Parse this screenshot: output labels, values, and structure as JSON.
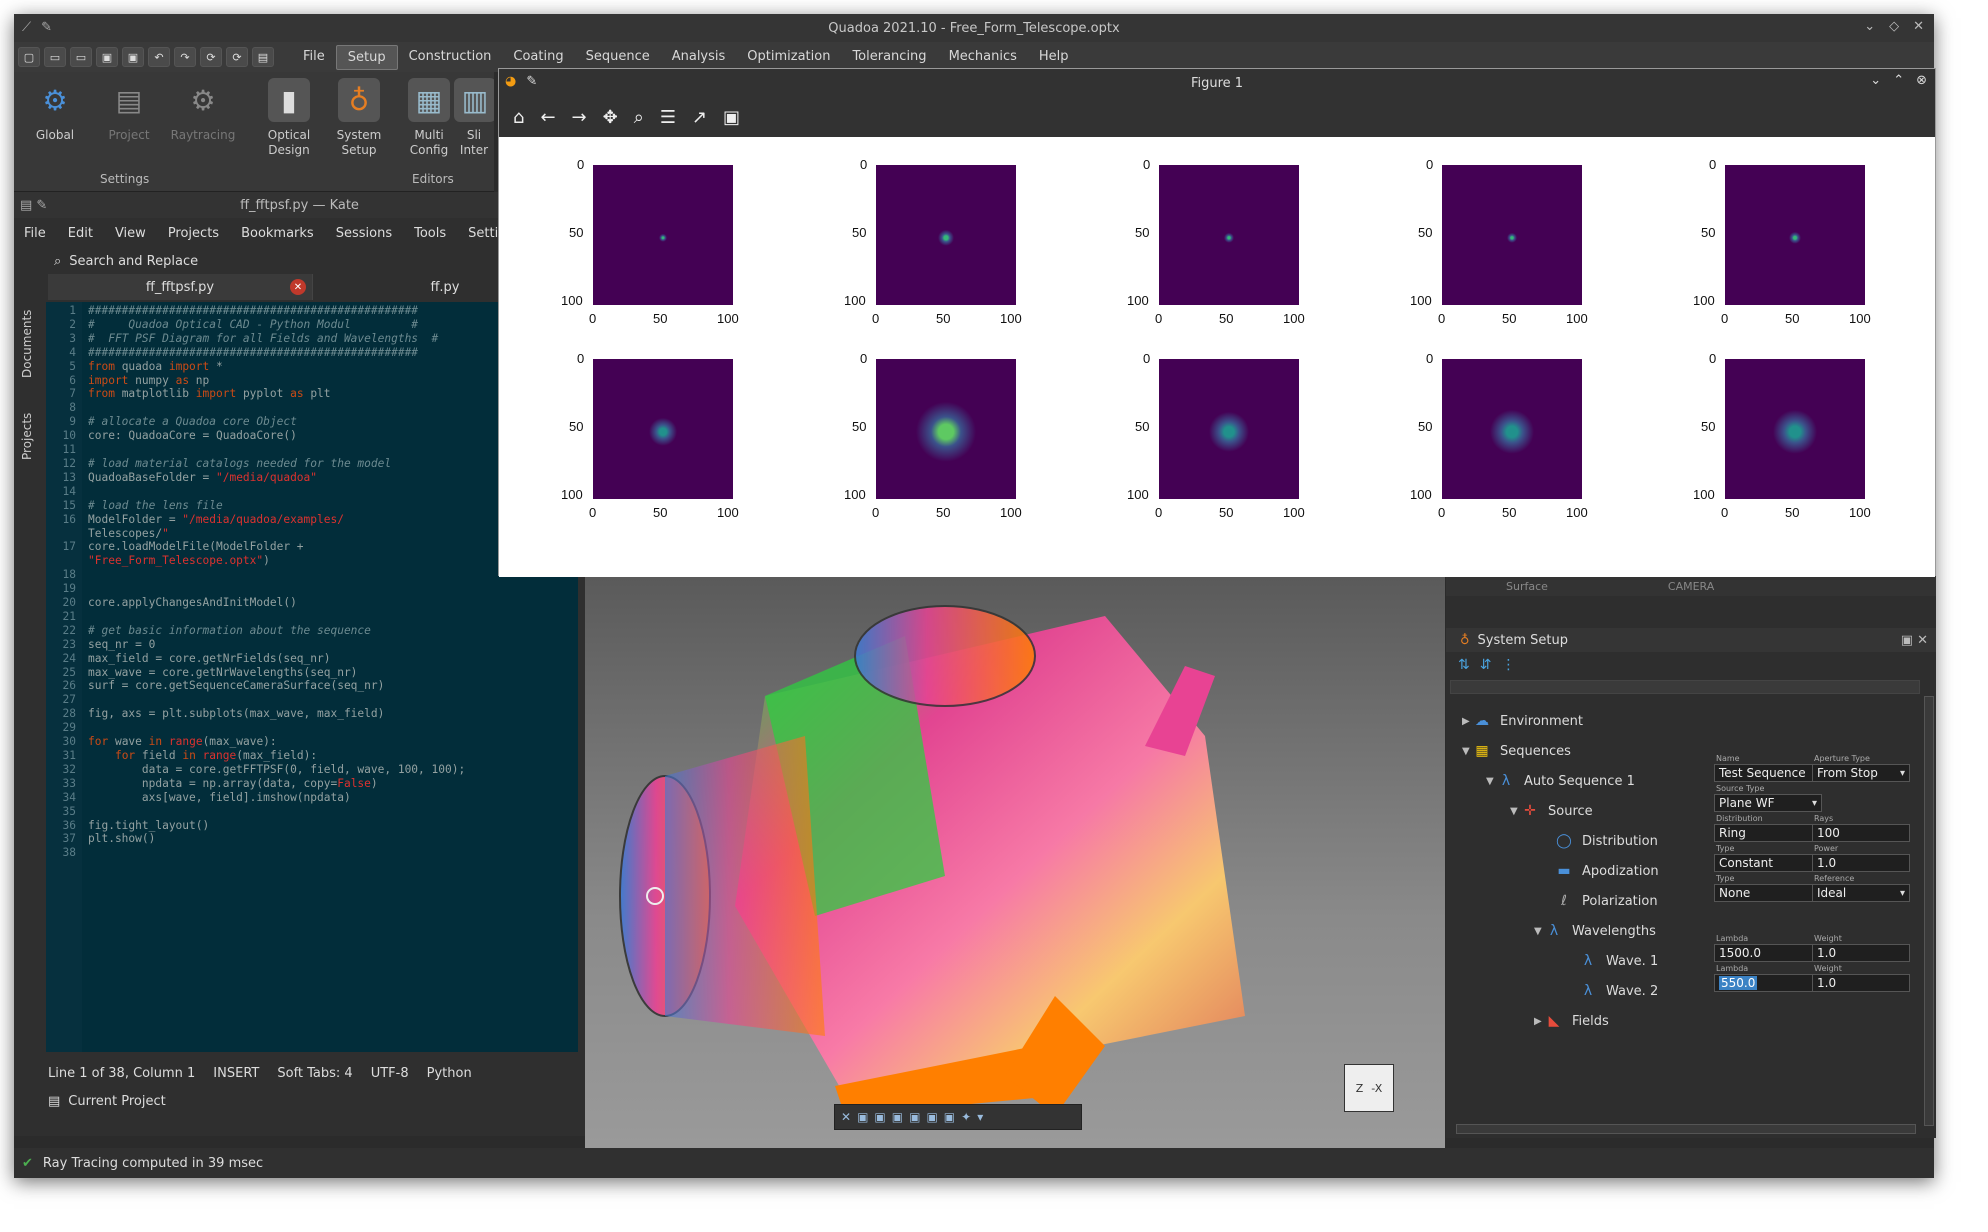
{
  "app": {
    "title": "Quadoa 2021.10 - Free_Form_Telescope.optx",
    "menu": [
      "File",
      "Setup",
      "Construction",
      "Coating",
      "Sequence",
      "Analysis",
      "Optimization",
      "Tolerancing",
      "Mechanics",
      "Help"
    ],
    "active_menu": "Setup"
  },
  "ribbon": {
    "settings_group": "Settings",
    "editors_group": "Editors",
    "buttons": [
      {
        "label": "Global",
        "icon": "gears-icon"
      },
      {
        "label": "Project",
        "icon": "document-gear-icon"
      },
      {
        "label": "Raytracing",
        "icon": "gpu-gear-icon"
      },
      {
        "label": "Optical\nDesign",
        "icon": "optical-design-icon"
      },
      {
        "label": "System\nSetup",
        "icon": "bulb-icon"
      },
      {
        "label": "Multi\nConfig",
        "icon": "multi-config-icon"
      },
      {
        "label": "Sli\nInter",
        "icon": "slice-icon"
      }
    ]
  },
  "kate": {
    "title": "ff_fftpsf.py — Kate",
    "menu": [
      "File",
      "Edit",
      "View",
      "Projects",
      "Bookmarks",
      "Sessions",
      "Tools",
      "Setting"
    ],
    "search_label": "Search and Replace",
    "side_tabs": [
      "Documents",
      "Projects"
    ],
    "tabs": [
      "ff_fftpsf.py",
      "ff.py"
    ],
    "status": {
      "position": "Line 1 of 38, Column 1",
      "mode": "INSERT",
      "tabs": "Soft Tabs: 4",
      "encoding": "UTF-8",
      "language": "Python"
    },
    "footer": "Current Project",
    "code_lines": [
      "#################################################",
      "#     Quadoa Optical CAD - Python Modul         #",
      "#  FFT PSF Diagram for all Fields and Wavelengths  #",
      "#################################################",
      "from quadoa import *",
      "import numpy as np",
      "from matplotlib import pyplot as plt",
      "",
      "# allocate a Quadoa core Object",
      "core: QuadoaCore = QuadoaCore()",
      "",
      "# load material catalogs needed for the model",
      "QuadoaBaseFolder = \"/media/quadoa\"",
      "",
      "# load the lens file",
      "ModelFolder = \"/media/quadoa/examples/",
      "Telescopes/\"",
      "core.loadModelFile(ModelFolder +",
      "\"Free_Form_Telescope.optx\")",
      "",
      "",
      "core.applyChangesAndInitModel()",
      "",
      "# get basic information about the sequence",
      "seq_nr = 0",
      "max_field = core.getNrFields(seq_nr)",
      "max_wave = core.getNrWavelengths(seq_nr)",
      "surf = core.getSequenceCameraSurface(seq_nr)",
      "",
      "fig, axs = plt.subplots(max_wave, max_field)",
      "",
      "for wave in range(max_wave):",
      "    for field in range(max_field):",
      "        data = core.getFFTPSF(0, field, wave, 100, 100);",
      "        npdata = np.array(data, copy=False)",
      "        axs[wave, field].imshow(npdata)",
      "",
      "fig.tight_layout()",
      "plt.show()",
      ""
    ],
    "line_numbers": [
      "1",
      "2",
      "3",
      "4",
      "5",
      "6",
      "7",
      "8",
      "9",
      "10",
      "11",
      "12",
      "13",
      "14",
      "15",
      "16",
      "",
      "17",
      "",
      "18",
      "19",
      "20",
      "21",
      "22",
      "23",
      "24",
      "25",
      "26",
      "27",
      "28",
      "29",
      "30",
      "31",
      "32",
      "33",
      "34",
      "35",
      "36",
      "37",
      "38"
    ]
  },
  "figure": {
    "title": "Figure 1",
    "toolbar": [
      "home-icon",
      "back-icon",
      "forward-icon",
      "pan-icon",
      "zoom-icon",
      "configure-icon",
      "axes-edit-icon",
      "save-icon"
    ],
    "tick_labels_y": [
      "0",
      "50",
      "100"
    ],
    "tick_labels_x": [
      "0",
      "50",
      "100"
    ]
  },
  "chart_data": {
    "type": "heatmap",
    "grid": "2x5 subplots",
    "xlim": [
      0,
      100
    ],
    "ylim": [
      100,
      0
    ],
    "xticks": [
      0,
      50,
      100
    ],
    "yticks": [
      0,
      50,
      100
    ],
    "colormap": "viridis",
    "background_color": "#440154"
  },
  "system_setup": {
    "title": "System Setup",
    "tree": {
      "environment": "Environment",
      "sequences": "Sequences",
      "auto_sequence": "Auto Sequence 1",
      "source": "Source",
      "distribution": "Distribution",
      "apodization": "Apodization",
      "polarization": "Polarization",
      "wavelengths": "Wavelengths",
      "wave1": "Wave. 1",
      "wave2": "Wave. 2",
      "fields": "Fields"
    },
    "fields": {
      "name_label": "Name",
      "name_value": "Test Sequence",
      "aperture_label": "Aperture Type",
      "aperture_value": "From Stop",
      "source_type_label": "Source Type",
      "source_type_value": "Plane WF",
      "dist_label": "Distribution",
      "dist_value": "Ring",
      "rays_label": "Rays",
      "rays_value": "100",
      "apod_type_label": "Type",
      "apod_type_value": "Constant",
      "power_label": "Power",
      "power_value": "1.0",
      "pol_type_label": "Type",
      "pol_type_value": "None",
      "reference_label": "Reference",
      "reference_value": "Ideal",
      "lambda_label": "Lambda",
      "lambda1_value": "1500.0",
      "weight_label": "Weight",
      "weight1_value": "1.0",
      "lambda2_value": "550.0",
      "weight2_value": "1.0"
    },
    "partial_text_top": "Surface",
    "partial_text_top2": "CAMERA"
  },
  "statusbar": {
    "message": "Ray Tracing computed in 39 msec"
  },
  "view_cube_label": "-X",
  "view_cube_label2": "Z"
}
